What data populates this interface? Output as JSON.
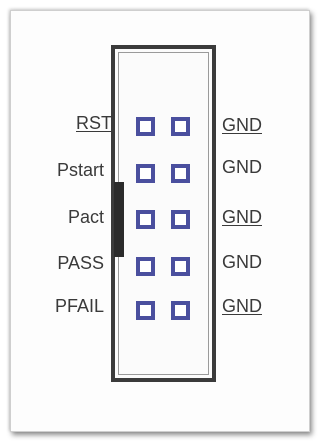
{
  "header": {
    "left_labels": [
      "RST",
      "Pstart",
      "Pact",
      "PASS",
      "PFAIL"
    ],
    "right_labels": [
      "GND",
      "GND",
      "GND",
      "GND",
      "GND"
    ]
  },
  "colors": {
    "pin_color": "#4a4f9e",
    "connector_border": "#3b3b3b",
    "text": "#3a3a3a"
  },
  "diagram": {
    "connector": "pin-header-2x5",
    "rows": 5,
    "columns": 2
  }
}
